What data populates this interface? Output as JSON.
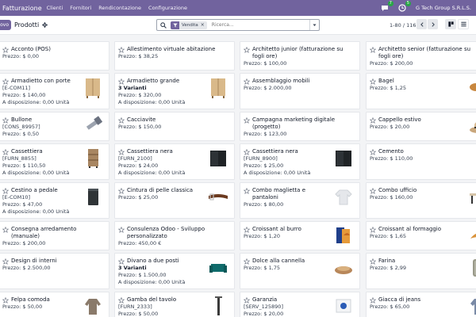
{
  "topbar": {
    "app_name": "Fatturazione",
    "menu": [
      "Clienti",
      "Fornitori",
      "Rendicontazione",
      "Configurazione"
    ],
    "chat_badge": "7",
    "activity_badge": "5",
    "company": "G Tech Group S.R.L.S."
  },
  "control": {
    "new_label": "ovo",
    "breadcrumb": "Prodotti",
    "facet_label": "Vendita",
    "search_placeholder": "Ricerca...",
    "pager": "1-80 / 116"
  },
  "colors": {
    "brand": "#71639e",
    "badge": "#28a745"
  },
  "products": [
    [
      {
        "name": "Acconto (POS)",
        "lines": [
          "Prezzo: $ 0,00"
        ],
        "icon": ""
      },
      {
        "name": "Armadietto con porte",
        "lines": [
          "[E-COM11]",
          "Prezzo: $ 140,00",
          "A disposizione: 0,00 Unità"
        ],
        "icon": "cabinet-wood-icon"
      },
      {
        "name": "Bullone",
        "lines": [
          "[CONS_89957]",
          "Prezzo: $ 0,50"
        ],
        "icon": "bolt-icon"
      },
      {
        "name": "Cassettiera",
        "lines": [
          "[FURN_8855]",
          "Prezzo: $ 110,50",
          "A disposizione: 0,00 Unità"
        ],
        "icon": "drawer-unit-icon"
      },
      {
        "name": "Cestino a pedale",
        "lines": [
          "[E-COM10]",
          "Prezzo: $ 47,00",
          "A disposizione: 0,00 Unità"
        ],
        "icon": "bin-icon"
      },
      {
        "name": "Consegna arredamento (manuale)",
        "lines": [
          "Prezzo: $ 200,00"
        ],
        "icon": ""
      },
      {
        "name": "Design di interni",
        "lines": [
          "Prezzo: $ 2.500,00"
        ],
        "icon": ""
      },
      {
        "name": "Felpa comoda",
        "lines": [
          "Prezzo: $ 50,00"
        ],
        "icon": "sweater-icon"
      }
    ],
    [
      {
        "name": "Allestimento virtuale abitazione",
        "lines": [
          "Prezzo: $ 38,25"
        ],
        "icon": ""
      },
      {
        "name": "Armadietto grande",
        "lines": [
          "3 Varianti",
          "Prezzo: $ 320,00",
          "A disposizione: 0,00 Unità"
        ],
        "bold": [
          0
        ],
        "icon": "cabinet-wood-icon"
      },
      {
        "name": "Cacciavite",
        "lines": [
          "Prezzo: $ 150,00"
        ],
        "icon": ""
      },
      {
        "name": "Cassettiera nera",
        "lines": [
          "[FURN_2100]",
          "Prezzo: $ 24,00",
          "A disposizione: 0,00 Unità"
        ],
        "icon": "black-drawer-icon"
      },
      {
        "name": "Cintura di pelle classica",
        "lines": [
          "Prezzo: $ 25,00"
        ],
        "icon": "belt-icon"
      },
      {
        "name": "Consulenza Odoo - Sviluppo personalizzato",
        "lines": [
          "Prezzo: 450,00 €"
        ],
        "icon": ""
      },
      {
        "name": "Divano a due posti",
        "lines": [
          "3 Varianti",
          "Prezzo: $ 1.500,00",
          "A disposizione: 0,00 Unità"
        ],
        "bold": [
          0
        ],
        "icon": "sofa-icon"
      },
      {
        "name": "Gamba del tavolo",
        "lines": [
          "[FURN_2333]",
          "Prezzo: $ 50,00"
        ],
        "icon": "table-leg-icon"
      }
    ],
    [
      {
        "name": "Architetto junior (fatturazione su fogli ore)",
        "lines": [
          "Prezzo: $ 100,00"
        ],
        "icon": ""
      },
      {
        "name": "Assemblaggio mobili",
        "lines": [
          "Prezzo: $ 2.000,00"
        ],
        "icon": ""
      },
      {
        "name": "Campagna marketing digitale (progetto)",
        "lines": [
          "Prezzo: $ 123,00"
        ],
        "icon": ""
      },
      {
        "name": "Cassettiera nera",
        "lines": [
          "[FURN_8900]",
          "Prezzo: $ 25,00",
          "A disposizione: 0,00 Unità"
        ],
        "icon": "black-drawer-icon"
      },
      {
        "name": "Combo maglietta e pantaloni",
        "lines": [
          "Prezzo: $ 80,00"
        ],
        "icon": "tshirt-icon"
      },
      {
        "name": "Croissant al burro",
        "lines": [
          "Prezzo: $ 1,20"
        ],
        "icon": "croissant-box-icon"
      },
      {
        "name": "Dolce alla cannella",
        "lines": [
          "Prezzo: $ 1,75"
        ],
        "icon": "pastry-icon"
      },
      {
        "name": "Garanzia",
        "lines": [
          "[SERV_125890]",
          "Prezzo: $ 20,00"
        ],
        "icon": "warranty-box-icon"
      }
    ],
    [
      {
        "name": "Architetto senior (fatturazione su fogli ore)",
        "lines": [
          "Prezzo: $ 200,00"
        ],
        "icon": ""
      },
      {
        "name": "Bagel",
        "lines": [
          "Prezzo: $ 1,25"
        ],
        "icon": "bagel-icon"
      },
      {
        "name": "Cappello estivo",
        "lines": [
          "Prezzo: $ 20,00"
        ],
        "icon": "hat-icon"
      },
      {
        "name": "Cemento",
        "lines": [
          "Prezzo: $ 110,00"
        ],
        "icon": ""
      },
      {
        "name": "Combo ufficio",
        "lines": [
          "Prezzo: $ 160,00"
        ],
        "icon": "desk-icon"
      },
      {
        "name": "Croissant al formaggio",
        "lines": [
          "Prezzo: $ 1,65"
        ],
        "icon": "croissant-icon"
      },
      {
        "name": "Farina",
        "lines": [
          "Prezzo: $ 2,99"
        ],
        "icon": "flour-icon"
      },
      {
        "name": "Giacca di jeans",
        "lines": [
          "Prezzo: $ 65,00"
        ],
        "icon": "jacket-icon"
      }
    ]
  ]
}
